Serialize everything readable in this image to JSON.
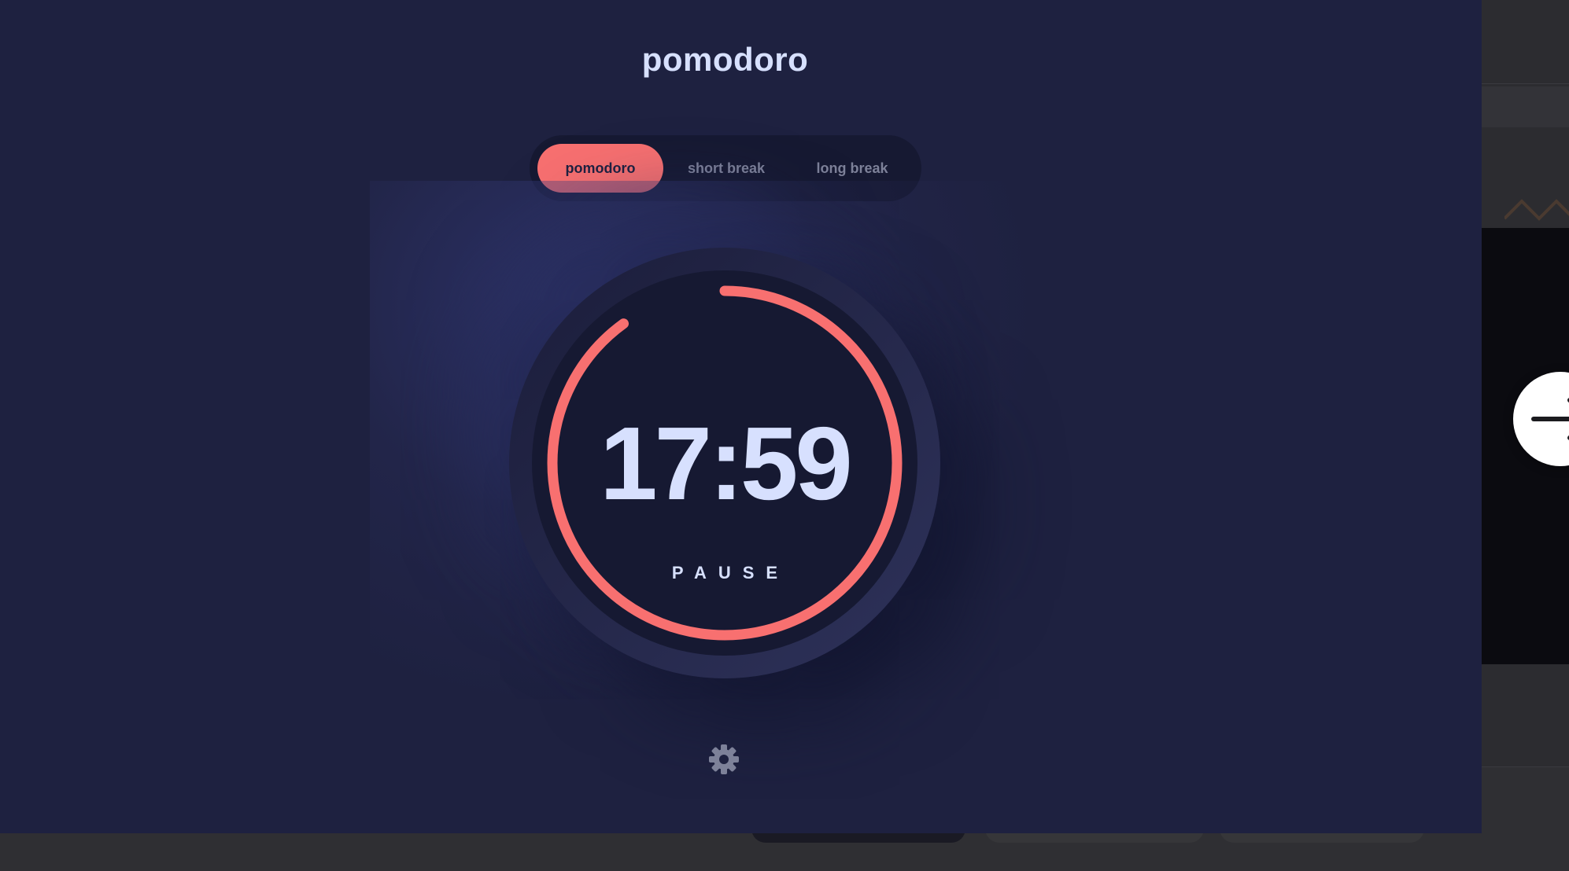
{
  "app": {
    "title": "pomodoro",
    "tabs": [
      {
        "label": "pomodoro",
        "active": true
      },
      {
        "label": "short break",
        "active": false
      },
      {
        "label": "long break",
        "active": false
      }
    ],
    "timer": {
      "time": "17:59",
      "action_label": "PAUSE",
      "progress_remaining": 0.9
    },
    "settings_icon": "gear-icon"
  },
  "next_button_icon": "arrow-right-icon",
  "colors": {
    "background": "#1e2140",
    "panel": "#161932",
    "accent": "#f87070",
    "text": "#d7e0fe",
    "muted": "#7d8199"
  }
}
